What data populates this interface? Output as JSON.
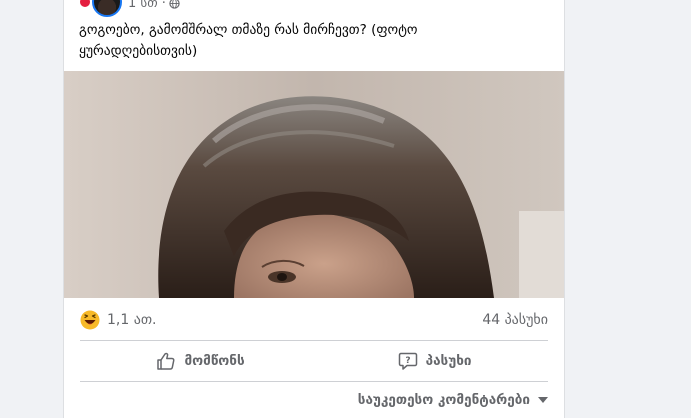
{
  "post": {
    "timestamp": "1 სთ ·",
    "text": "გოგოებო, გამომშრალ თმაზე რას მირჩევთ? (ფოტო ყურადღებისთვის)"
  },
  "reactions": {
    "count": "1,1 ათ.",
    "comments": "44 პასუხი"
  },
  "actions": {
    "like": "მომწონს",
    "comment": "პასუხი"
  },
  "comments_sort": {
    "label": "საუკეთესო კომენტარები"
  },
  "icons": {
    "reaction": "haha-emoji-icon",
    "like": "thumbs-up-icon",
    "comment": "speech-bubble-icon",
    "privacy": "globe-icon",
    "sort": "chevron-down-icon"
  }
}
